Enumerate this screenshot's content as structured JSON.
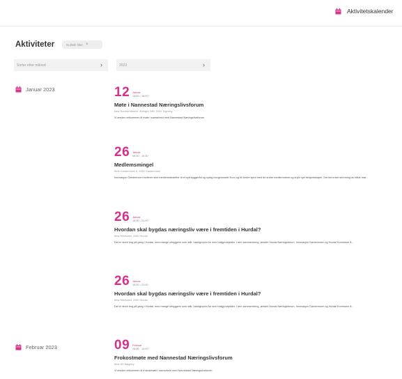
{
  "topbar": {
    "calendar_link": "Aktivitetskalender",
    "accent_color": "#d6308a"
  },
  "filters": {
    "title": "Aktiviteter",
    "chip_label": "Nullstill filter",
    "chip_close": "×",
    "sort_select": "Sorter etter måned",
    "year_select": "2023"
  },
  "months": [
    {
      "label": "Januar 2023"
    },
    {
      "label": "Februar 2023"
    }
  ],
  "events": [
    {
      "day": "12",
      "month": "Januar",
      "time": "14:00 - 18:00",
      "title": "Møte i Nannestad Næringslivsforum",
      "location": "Best Nordby Maskin, Årvegen 285, 2031 Tegneby",
      "description": "Vi ønsker velkommen til møte i samarbeid med Nannestad Næringslivsforum."
    },
    {
      "day": "26",
      "month": "Januar",
      "time": "08:30 - 10:30",
      "title": "Medlemsmingel",
      "location": "Best Gardermoen 6, 2060 Gardermoen",
      "description": "Innovasjon Gardermoen inviterer sine medlemsbedrifter til et nytt byggeråd og nyttig morgenmøte! Kom og bli bedre kjent med de andre medlemmene og knytt nye bekjentskaper. Det blir enkel servering av både mat..."
    },
    {
      "day": "26",
      "month": "Januar",
      "time": "18:00 - 21:00",
      "title": "Hvordan skal bygdas næringsliv være i fremtiden i Hurdal?",
      "location": "Best Rådhuset, 2090 Hurdal",
      "description": "Det er store ting på gang i Hurdal, med mange utbyggere som står i startgropen for sine boligprosjekter. I den sammenheng, ønsker Hurdal Næringsforum, Innovasjon Gardermoen og Hurdal Kommune å..."
    },
    {
      "day": "26",
      "month": "Januar",
      "time": "18:00 - 21:00",
      "title": "Hvordan skal bygdas næringsliv være i fremtiden i Hurdal?",
      "location": "Best Rådhuset, 2090 Hurdal",
      "description": "Det er store ting på gang i Hurdal, med mange utbyggere som står i startgropen for sine boligprosjekter. I den sammenheng, ønsker Hurdal Næringsforum, Innovasjon Gardermoen og Hurdal Kommune å..."
    },
    {
      "day": "09",
      "month": "Februar",
      "time": "08:00 - 10:00",
      "title": "Frokostmøte med Nannestad Næringslivsforum",
      "location": "Best AS Bølgeby",
      "description": "Vi ønsker velkommen til frokostmøte i samarbeid med Nannestad Næringslivsforum."
    }
  ]
}
